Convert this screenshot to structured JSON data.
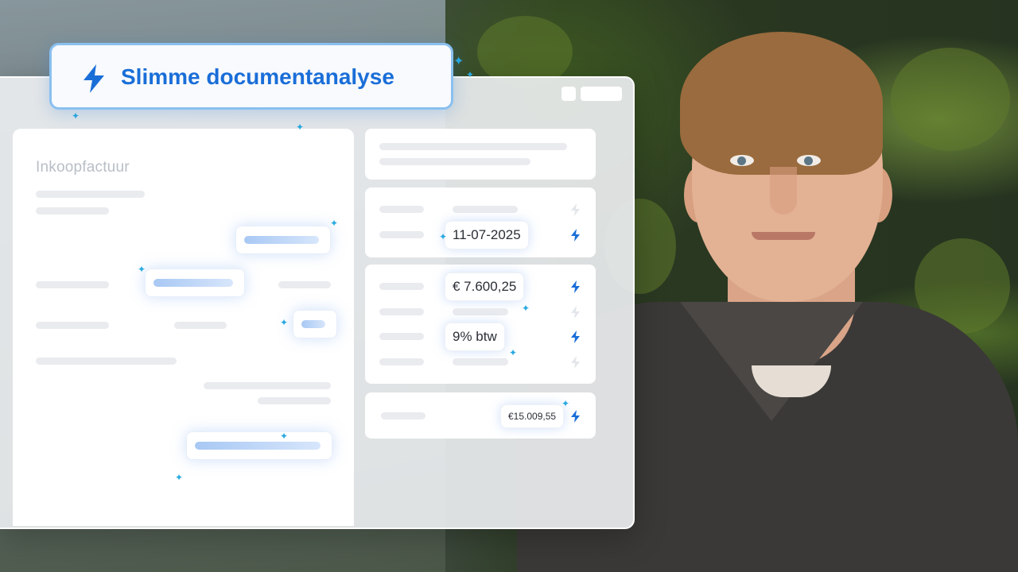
{
  "header": {
    "title": "Slimme documentanalyse",
    "icon": "lightning-bolt-icon"
  },
  "document": {
    "title": "Inkoopfactuur"
  },
  "extracted": {
    "date": "11-07-2025",
    "amount": "€ 7.600,25",
    "vat": "9% btw",
    "total": "€15.009,55"
  },
  "colors": {
    "accent": "#1a6ed8",
    "sparkle": "#29a9e0",
    "highlight": "#a8c8f4"
  }
}
